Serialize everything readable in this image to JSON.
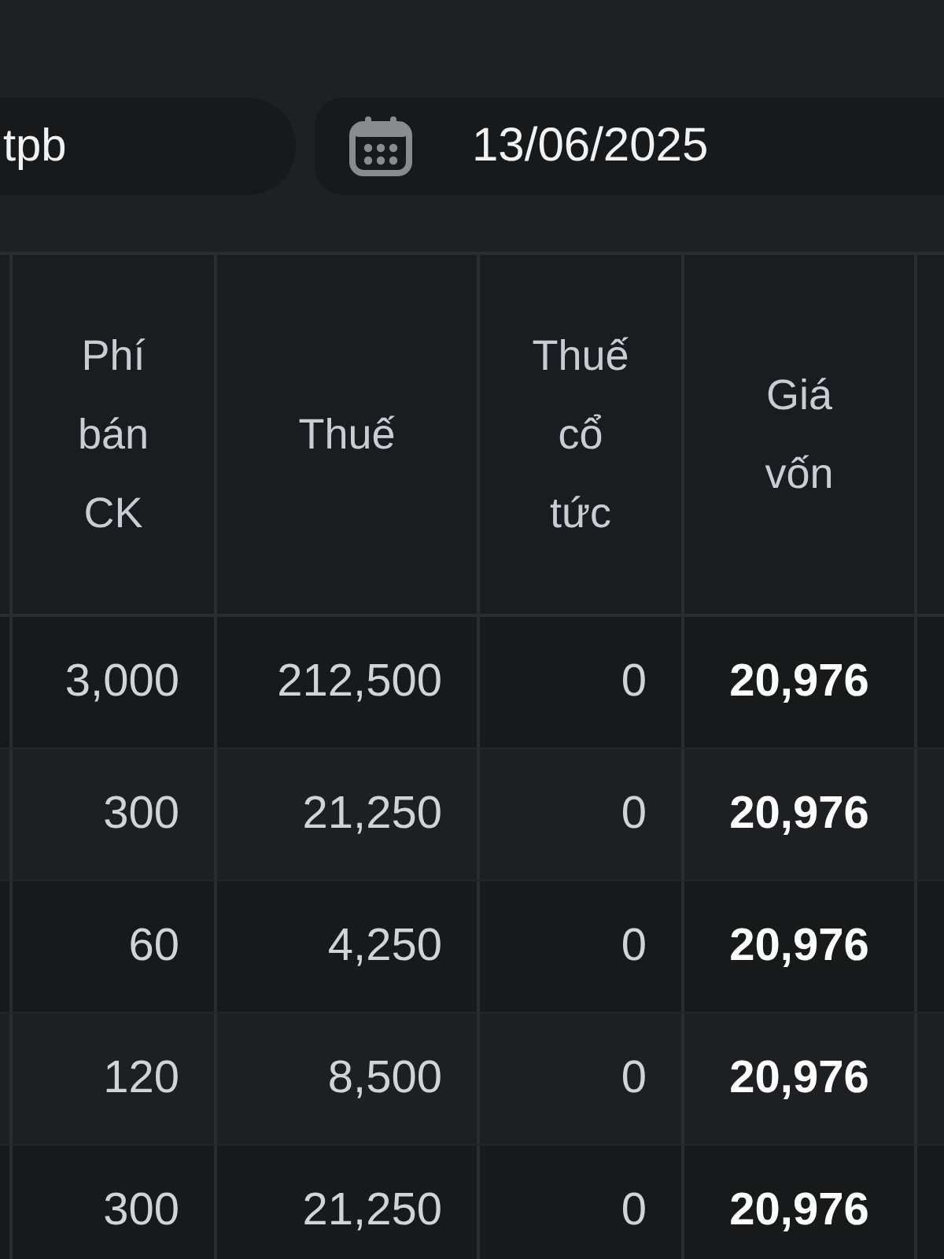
{
  "filter": {
    "symbol": "tpb",
    "date": "13/06/2025"
  },
  "table": {
    "columns": [
      "Phí bán CK",
      "Thuế",
      "Thuế cổ tức",
      "Giá vốn"
    ],
    "rows": [
      {
        "cells": [
          "3,000",
          "212,500",
          "0",
          "20,976"
        ]
      },
      {
        "cells": [
          "300",
          "21,250",
          "0",
          "20,976"
        ]
      },
      {
        "cells": [
          "60",
          "4,250",
          "0",
          "20,976"
        ]
      },
      {
        "cells": [
          "120",
          "8,500",
          "0",
          "20,976"
        ]
      },
      {
        "cells": [
          "300",
          "21,250",
          "0",
          "20,976"
        ]
      }
    ]
  }
}
